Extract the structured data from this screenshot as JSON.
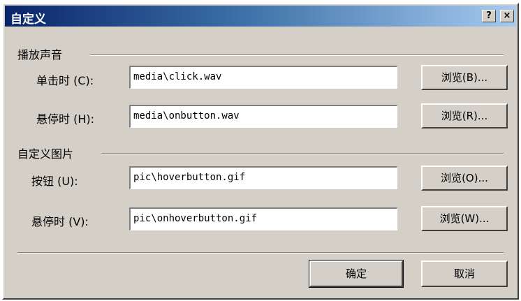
{
  "dialog": {
    "title": "自定义",
    "help_button": "?",
    "close_button": "×"
  },
  "sound_group": {
    "label": "播放声音",
    "click": {
      "label": "单击时 (C):",
      "value": "media\\click.wav",
      "browse": "浏览(B)..."
    },
    "hover": {
      "label": "悬停时 (H):",
      "value": "media\\onbutton.wav",
      "browse": "浏览(R)..."
    }
  },
  "image_group": {
    "label": "自定义图片",
    "button": {
      "label": "按钮 (U):",
      "value": "pic\\hoverbutton.gif",
      "browse": "浏览(O)..."
    },
    "hover": {
      "label": "悬停时 (V):",
      "value": "pic\\onhoverbutton.gif",
      "browse": "浏览(W)..."
    }
  },
  "footer": {
    "ok": "确定",
    "cancel": "取消"
  }
}
